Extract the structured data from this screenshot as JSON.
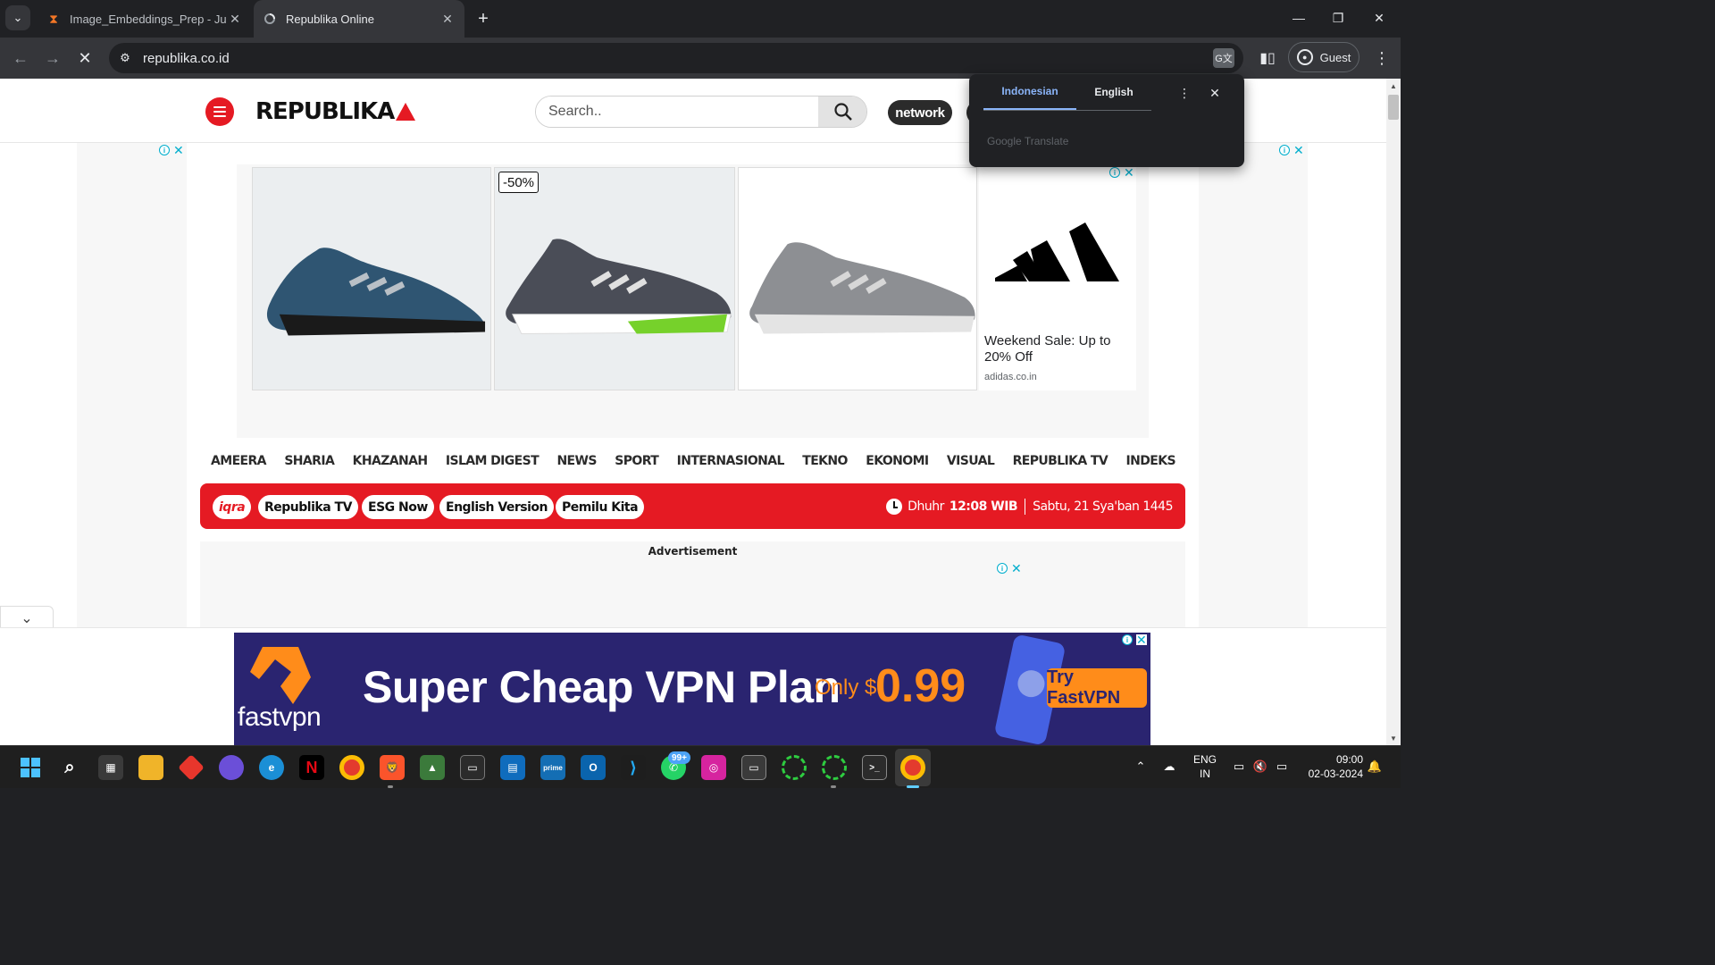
{
  "browser": {
    "tabs": [
      {
        "title": "Image_Embeddings_Prep - Jupy",
        "icon": "hourglass-icon"
      },
      {
        "title": "Republika Online",
        "icon": "loading-icon"
      }
    ],
    "url": "republika.co.id",
    "profile_label": "Guest"
  },
  "site": {
    "logo_text": "REPUBLIKA",
    "search_placeholder": "Search..",
    "network_label": "network"
  },
  "top_ad": {
    "discount_badge": "-50%",
    "headline": "Weekend Sale: Up to 20% Off",
    "domain": "adidas.co.in",
    "shoe_colors": [
      "#2f5572",
      "#4a4d57",
      "#8d8f93"
    ]
  },
  "main_nav": [
    "AMEERA",
    "SHARIA",
    "KHAZANAH",
    "ISLAM DIGEST",
    "NEWS",
    "SPORT",
    "INTERNASIONAL",
    "TEKNO",
    "EKONOMI",
    "VISUAL",
    "REPUBLIKA TV",
    "INDEKS"
  ],
  "red_bar": {
    "chips": [
      "iqra",
      "Republika TV",
      "ESG Now",
      "English Version",
      "Pemilu Kita"
    ],
    "prayer_name": "Dhuhr",
    "prayer_time": "12:08 WIB",
    "hijri_date": "Sabtu, 21 Sya'ban 1445"
  },
  "ad_section": {
    "label": "Advertisement"
  },
  "sticky_ad": {
    "brand": "fastvpn",
    "headline": "Super Cheap VPN Plan",
    "only": "Only $",
    "price": "0.99",
    "cta": "Try FastVPN"
  },
  "translate_popup": {
    "source_lang": "Indonesian",
    "target_lang": "English",
    "brand": "Google Translate"
  },
  "taskbar": {
    "lang_line1": "ENG",
    "lang_line2": "IN",
    "time": "09:00",
    "date": "02-03-2024",
    "whatsapp_badge": "99+"
  },
  "colors": {
    "brand_red": "#e51a23",
    "chrome_dark": "#202124",
    "chrome_toolbar": "#35363a",
    "translate_accent": "#8ab4f8",
    "vpn_orange": "#ff8c1a"
  }
}
